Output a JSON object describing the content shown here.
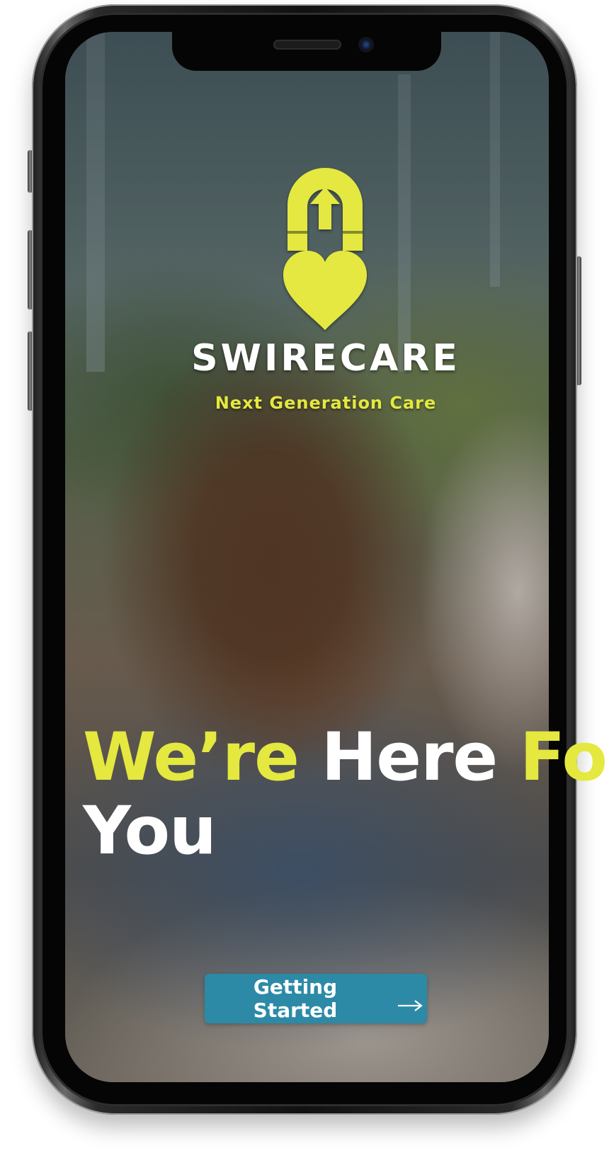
{
  "app": {
    "brand_name": "SWIRECARE",
    "tagline": "Next Generation Care",
    "logo_icon": "footprint-arrow-heart-icon",
    "accent_color": "#e4e83f",
    "button_color": "#2c8aa6"
  },
  "hero": {
    "headline_word_1": "We’re",
    "headline_word_2": "Here",
    "headline_word_3": "For",
    "headline_word_4": "You"
  },
  "cta": {
    "label": "Getting Started",
    "icon": "arrow-right-icon"
  }
}
